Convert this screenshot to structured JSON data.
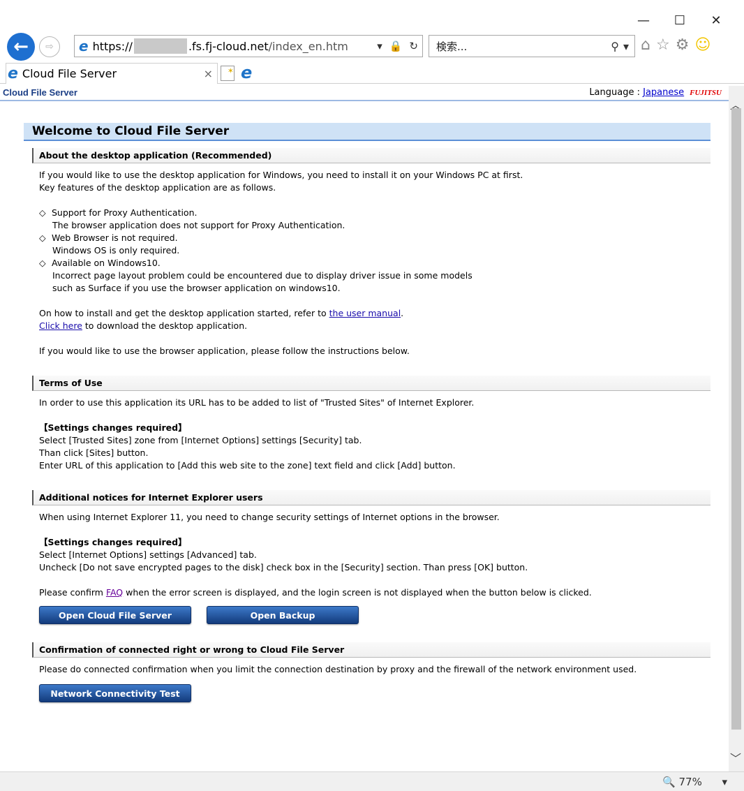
{
  "window": {
    "minimize": "—",
    "maximize": "☐",
    "close": "✕"
  },
  "nav": {
    "back_icon": "←",
    "forward_icon": "⇨",
    "address": {
      "protocol": "https://",
      "host_suffix": ".fs.fj-cloud.net",
      "path": "/index_en.htm",
      "dropdown_icon": "▾",
      "lock_icon": "🔒",
      "refresh_icon": "↻"
    },
    "search": {
      "placeholder": "検索...",
      "search_icon": "⚲",
      "dropdown_icon": "▾"
    },
    "toolbar_icons": {
      "home": "⌂",
      "favorites": "☆",
      "settings": "⚙",
      "feedback": "☺"
    }
  },
  "tab": {
    "title": "Cloud File Server",
    "close": "×"
  },
  "header": {
    "brand": "Cloud File Server",
    "language_label": "Language : ",
    "language_link": "Japanese",
    "logo_text": "FUJITSU"
  },
  "page": {
    "welcome": "Welcome to Cloud File Server",
    "desktop": {
      "heading": "About the desktop application (Recommended)",
      "intro_1": "If you would like to use the desktop application for Windows, you need to install it on your Windows PC at first.",
      "intro_2": "Key features of the desktop application are as follows.",
      "f1_title": "Support for Proxy Authentication.",
      "f1_desc": "The browser application does not support for Proxy Authentication.",
      "f2_title": "Web Browser is not required.",
      "f2_desc": "Windows OS is only required.",
      "f3_title": "Available on Windows10.",
      "f3_desc_1": "Incorrect page layout problem could be encountered due to display driver issue in some models",
      "f3_desc_2": "such as Surface if you use the browser application on windows10.",
      "manual_prefix": "On how to install and get the desktop application started, refer to ",
      "manual_link": "the user manual",
      "manual_suffix": ".",
      "download_link": "Click here",
      "download_suffix": " to download the desktop application.",
      "browser_note": "If you would like to use the browser application, please follow the instructions below."
    },
    "terms": {
      "heading": "Terms of Use",
      "intro": "In order to use this application its URL has to be added to list of \"Trusted Sites\" of Internet Explorer.",
      "settings_title": "【Settings changes required】",
      "step_1": "Select [Trusted Sites] zone from [Internet Options] settings [Security] tab.",
      "step_2": "Than click [Sites] button.",
      "step_3": "Enter URL of this application to [Add this web site to the zone] text field and click [Add] button."
    },
    "ie": {
      "heading": "Additional notices for Internet Explorer users",
      "intro": "When using Internet Explorer 11, you need to change security settings of Internet options in the browser.",
      "settings_title": "【Settings changes required】",
      "step_1": "Select [Internet Options] settings [Advanced] tab.",
      "step_2": "Uncheck [Do not save encrypted pages to the disk] check box in the [Security] section. Than press [OK] button.",
      "faq_prefix": "Please confirm ",
      "faq_link": "FAQ",
      "faq_suffix": " when the error screen is displayed, and the login screen is not displayed when the button below is clicked.",
      "open_button": "Open Cloud File Server",
      "backup_button": "Open Backup"
    },
    "connect": {
      "heading": "Confirmation of connected right or wrong to Cloud File Server",
      "intro": "Please do connected confirmation when you limit the connection destination by proxy and the firewall of the network environment used.",
      "test_button": "Network Connectivity Test"
    },
    "diamond": "◇"
  },
  "scrollbar": {
    "up": "︿",
    "down": "﹀"
  },
  "status": {
    "zoom_icon": "🔍",
    "zoom": "77%",
    "zoom_dropdown": "▾"
  }
}
